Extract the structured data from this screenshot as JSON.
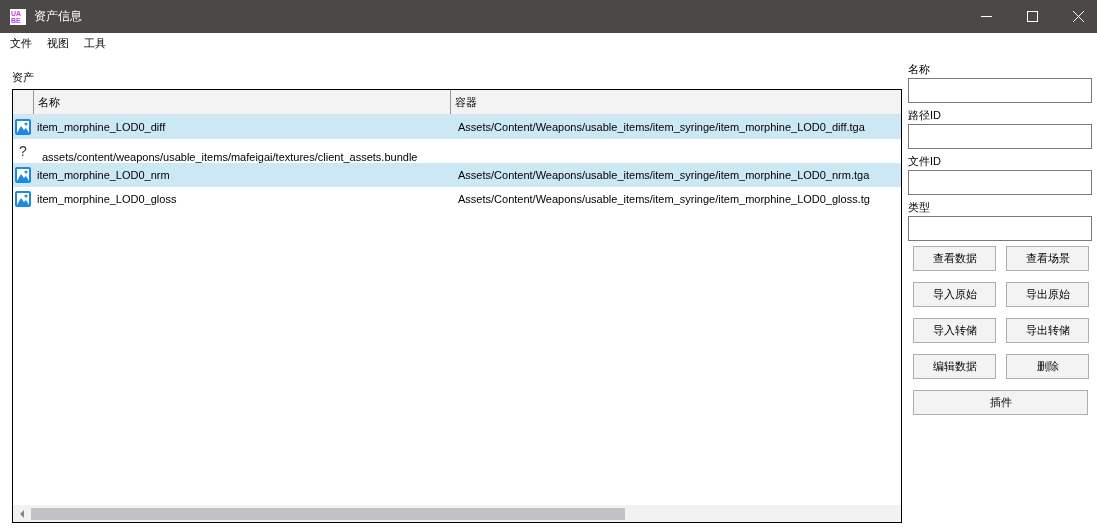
{
  "window": {
    "title": "资产信息",
    "app_icon_text": [
      "UA",
      "BE"
    ]
  },
  "menu": [
    "文件",
    "视图",
    "工具"
  ],
  "assets_label": "资产",
  "table": {
    "columns": [
      "名称",
      "容器"
    ],
    "rows": [
      {
        "kind": "image",
        "name": "item_morphine_LOD0_diff",
        "container": "Assets/Content/Weapons/usable_items/item_syringe/item_morphine_LOD0_diff.tga",
        "selected": true
      },
      {
        "kind": "unknown",
        "icon_text": "?",
        "name": "assets/content/weapons/usable_items/mafeigai/textures/client_assets.bundle",
        "selected": false
      },
      {
        "kind": "image",
        "name": "item_morphine_LOD0_nrm",
        "container": "Assets/Content/Weapons/usable_items/item_syringe/item_morphine_LOD0_nrm.tga",
        "selected": true
      },
      {
        "kind": "image",
        "name": "item_morphine_LOD0_gloss",
        "container": "Assets/Content/Weapons/usable_items/item_syringe/item_morphine_LOD0_gloss.tg",
        "selected": false
      }
    ]
  },
  "fields": [
    {
      "label": "名称"
    },
    {
      "label": "路径ID"
    },
    {
      "label": "文件ID"
    },
    {
      "label": "类型"
    }
  ],
  "buttons": [
    "查看数据",
    "查看场景",
    "导入原始",
    "导出原始",
    "导入转储",
    "导出转储",
    "编辑数据",
    "删除"
  ],
  "wide_button": "插件"
}
